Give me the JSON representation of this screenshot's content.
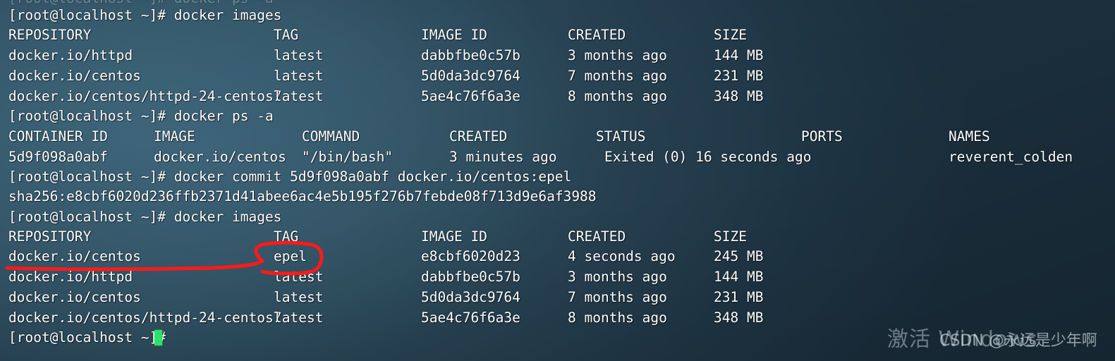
{
  "terminal": {
    "background_color": "#2a4658",
    "foreground_color": "#ffffff",
    "cursor_color": "#2ee06a",
    "prompt": "[root@localhost ~]#",
    "cut_off_top_line": "[root@localhost ~]# docker ps -a",
    "lines": [
      {
        "id": "cmd-docker-images-1",
        "text": "[root@localhost ~]# docker images"
      },
      {
        "id": "cmd-docker-ps-a",
        "text": "[root@localhost ~]# docker ps -a"
      },
      {
        "id": "cmd-docker-commit",
        "text": "[root@localhost ~]# docker commit 5d9f098a0abf docker.io/centos:epel"
      },
      {
        "id": "out-sha256",
        "text": "sha256:e8cbf6020d236ffb2371d41abee6ac4e5b195f276b7febde08f713d9e6af3988"
      },
      {
        "id": "cmd-docker-images-2",
        "text": "[root@localhost ~]# docker images"
      },
      {
        "id": "prompt-final",
        "text": "[root@localhost ~]#"
      }
    ]
  },
  "images_table_1": {
    "headers": [
      "REPOSITORY",
      "TAG",
      "IMAGE ID",
      "CREATED",
      "SIZE"
    ],
    "rows": [
      [
        "docker.io/httpd",
        "latest",
        "dabbfbe0c57b",
        "3 months ago",
        "144 MB"
      ],
      [
        "docker.io/centos",
        "latest",
        "5d0da3dc9764",
        "7 months ago",
        "231 MB"
      ],
      [
        "docker.io/centos/httpd-24-centos7",
        "latest",
        "5ae4c76f6a3e",
        "8 months ago",
        "348 MB"
      ]
    ]
  },
  "ps_table": {
    "headers": [
      "CONTAINER ID",
      "IMAGE",
      "COMMAND",
      "CREATED",
      "STATUS",
      "PORTS",
      "NAMES"
    ],
    "rows": [
      [
        "5d9f098a0abf",
        "docker.io/centos",
        "\"/bin/bash\"",
        "3 minutes ago",
        "Exited (0) 16 seconds ago",
        "",
        "reverent_colden"
      ]
    ]
  },
  "images_table_2": {
    "headers": [
      "REPOSITORY",
      "TAG",
      "IMAGE ID",
      "CREATED",
      "SIZE"
    ],
    "rows": [
      [
        "docker.io/centos",
        "epel",
        "e8cbf6020d23",
        "4 seconds ago",
        "245 MB"
      ],
      [
        "docker.io/httpd",
        "latest",
        "dabbfbe0c57b",
        "3 months ago",
        "144 MB"
      ],
      [
        "docker.io/centos",
        "latest",
        "5d0da3dc9764",
        "7 months ago",
        "231 MB"
      ],
      [
        "docker.io/centos/httpd-24-centos7",
        "latest",
        "5ae4c76f6a3e",
        "8 months ago",
        "348 MB"
      ]
    ]
  },
  "annotation": {
    "color": "#ff1a1a",
    "shape": "underline-and-circle",
    "circled_text": "epel",
    "underlined_row": "docker.io/centos"
  },
  "watermarks": {
    "windows_activation": "激活 Windows",
    "csdn": "CSDN @永远是少年啊"
  }
}
